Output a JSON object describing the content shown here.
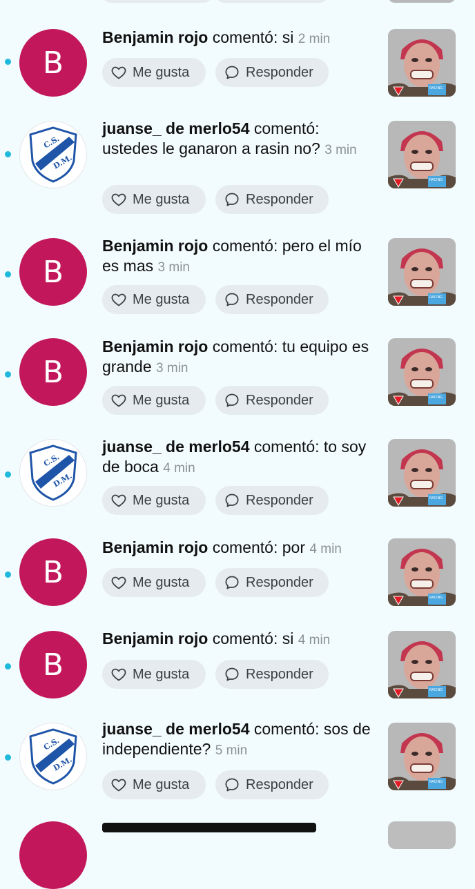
{
  "comments": [
    {
      "author": "Benjamin rojo",
      "verb": "comentó:",
      "text": "si",
      "time": "2 min",
      "avatar": "B",
      "avatar_type": "letter"
    },
    {
      "author": "juanse_ de merlo54",
      "verb": "comentó:",
      "text": "ustedes le ganaron a rasin no?",
      "time": "3 min",
      "avatar": "club-crest-icon",
      "avatar_type": "club"
    },
    {
      "author": "Benjamin rojo",
      "verb": "comentó:",
      "text": "pero el mío es mas",
      "time": "3 min",
      "avatar": "B",
      "avatar_type": "letter"
    },
    {
      "author": "Benjamin rojo",
      "verb": "comentó:",
      "text": "tu equipo es grande",
      "time": "3 min",
      "avatar": "B",
      "avatar_type": "letter"
    },
    {
      "author": "juanse_ de merlo54",
      "verb": "comentó:",
      "text": "to soy de boca",
      "time": "4 min",
      "avatar": "club-crest-icon",
      "avatar_type": "club"
    },
    {
      "author": "Benjamin rojo",
      "verb": "comentó:",
      "text": "por",
      "time": "4 min",
      "avatar": "B",
      "avatar_type": "letter"
    },
    {
      "author": "Benjamin rojo",
      "verb": "comentó:",
      "text": "si",
      "time": "4 min",
      "avatar": "B",
      "avatar_type": "letter"
    },
    {
      "author": "juanse_ de merlo54",
      "verb": "comentó:",
      "text": "sos de independiente?",
      "time": "5 min",
      "avatar": "club-crest-icon",
      "avatar_type": "club"
    }
  ],
  "actions": {
    "like_label": "Me gusta",
    "reply_label": "Responder"
  },
  "crest_text": {
    "top": "C.S.",
    "bottom": "D.M."
  },
  "thumbnail": {
    "badge_text": "RACING",
    "icon": "video-thumbnail-face"
  },
  "colors": {
    "dot": "#1fb9dd",
    "letter_avatar": "#c2185b",
    "button_bg": "#e5ebee",
    "crest_band": "#1f55a8"
  }
}
